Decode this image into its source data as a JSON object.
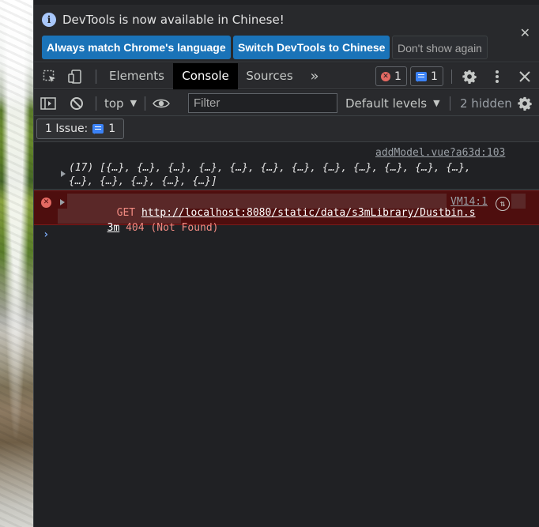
{
  "infobar": {
    "message": "DevTools is now available in Chinese!",
    "btn_match": "Always match Chrome's language",
    "btn_switch": "Switch DevTools to Chinese",
    "btn_dismiss": "Don't show again",
    "close_glyph": "✕"
  },
  "tabs": {
    "elements": "Elements",
    "console": "Console",
    "sources": "Sources",
    "more_glyph": "»"
  },
  "badges": {
    "errors": "1",
    "messages": "1"
  },
  "console_toolbar": {
    "context": "top",
    "filter_placeholder": "Filter",
    "levels": "Default levels",
    "hidden": "2 hidden"
  },
  "issues": {
    "label": "1 Issue:",
    "count": "1"
  },
  "messages": {
    "log_source": "addModel.vue?a63d:103",
    "log_line1": "(17) [{…}, {…}, {…}, {…}, {…}, {…}, {…}, {…}, {…}, {…}, {…}, {…},",
    "log_line2": "{…}, {…}, {…}, {…}, {…}]",
    "error_method": "GET ",
    "error_url_part1": "http://localhost:8080/static/data/s3mLibrary/Dustbin.s",
    "error_url_part2": "3m",
    "error_status": " 404 (Not Found)",
    "error_source": "VM14:1",
    "prompt": "›"
  },
  "colors": {
    "accent": "#1a73b8",
    "error": "#e46962",
    "error_bg": "#4e0e0e",
    "info": "#3b82f6"
  }
}
